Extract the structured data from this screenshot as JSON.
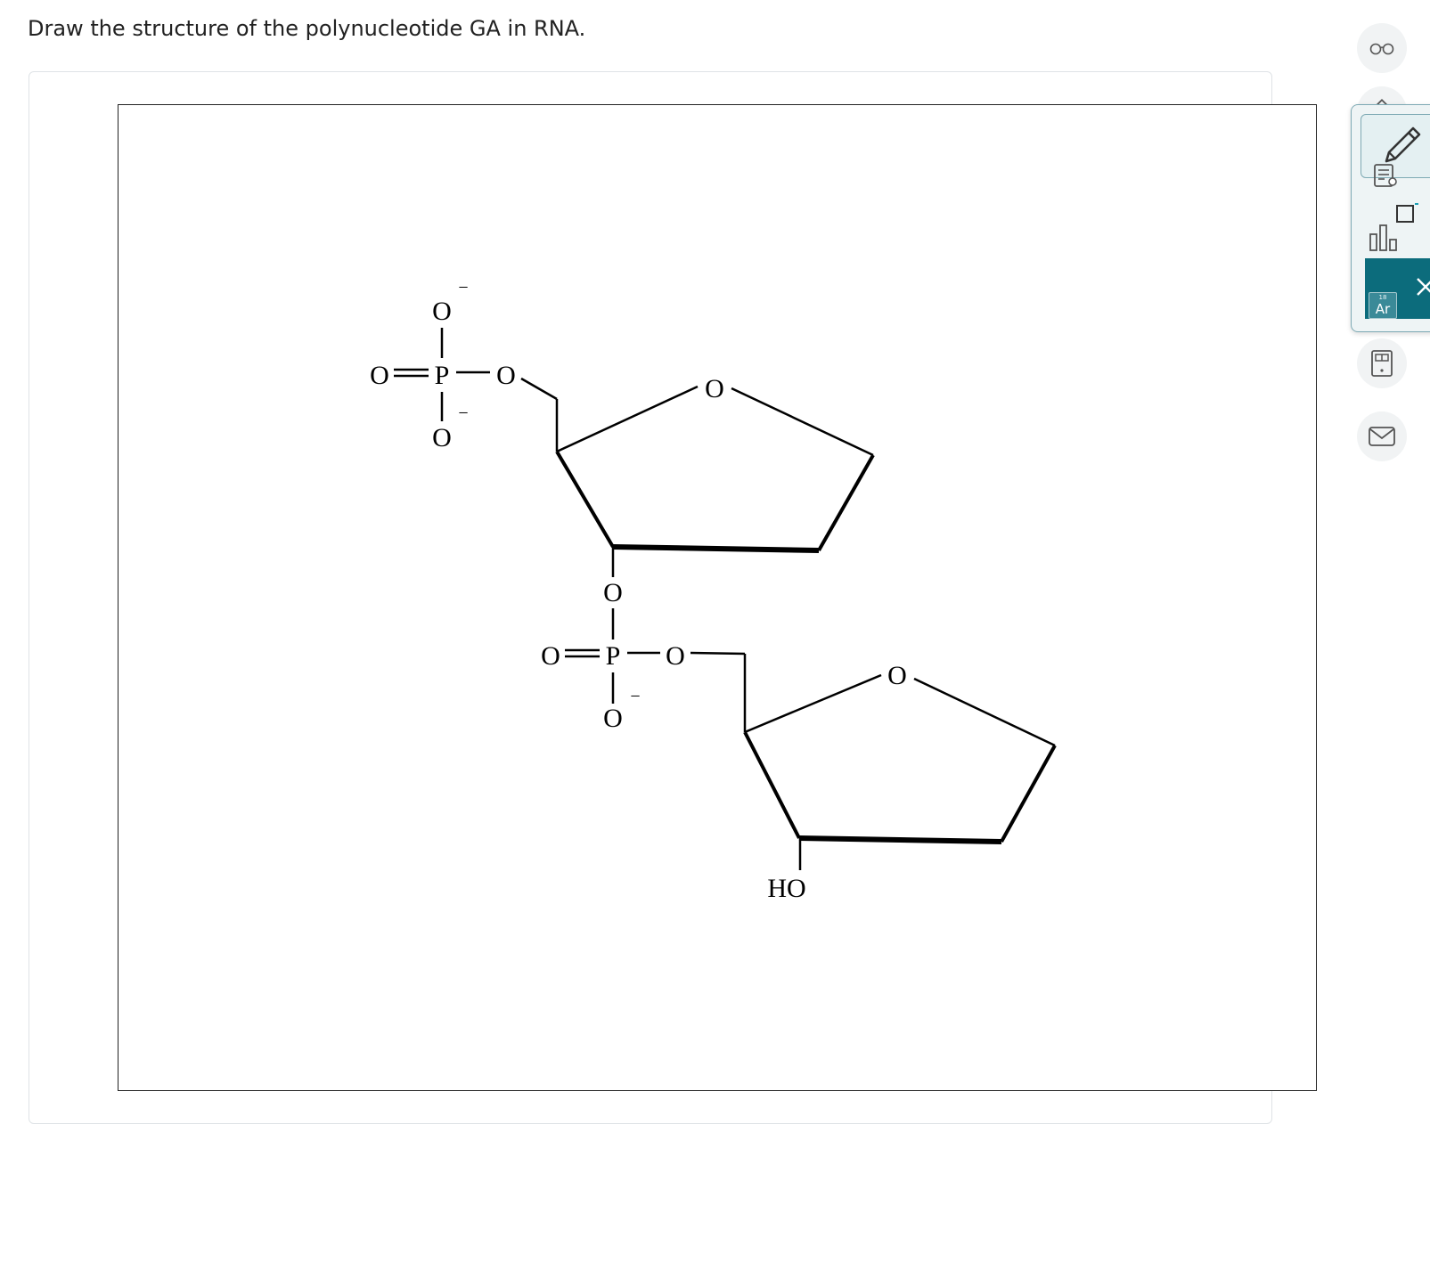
{
  "question": {
    "text": "Draw the structure of the polynucleotide GA in RNA."
  },
  "molecule": {
    "atoms": {
      "o_top_1": "O",
      "o_dbl_1": "O",
      "p_1": "P",
      "o_ester_1": "O",
      "o_bot_1": "O",
      "o_ring_1": "O",
      "o_link_2": "O",
      "o_dbl_2": "O",
      "p_2": "P",
      "o_ester_2": "O",
      "o_bot_2": "O",
      "o_ring_2": "O",
      "ho_3prime": "HO"
    },
    "charges": {
      "c_top_1": "−",
      "c_bot_1": "−",
      "c_bot_2": "−"
    }
  },
  "sidebar": {
    "tools": [
      "glasses-icon",
      "draw-icon",
      "notes-icon",
      "chart-icon",
      "periodic-table-icon",
      "calculator-icon",
      "mail-icon"
    ],
    "periodic": {
      "number": "18",
      "symbol": "Ar"
    }
  },
  "colors": {
    "accent_dark_teal": "#0c6c7c",
    "popout_border": "#7eaab4",
    "icon_gray": "#555555"
  }
}
